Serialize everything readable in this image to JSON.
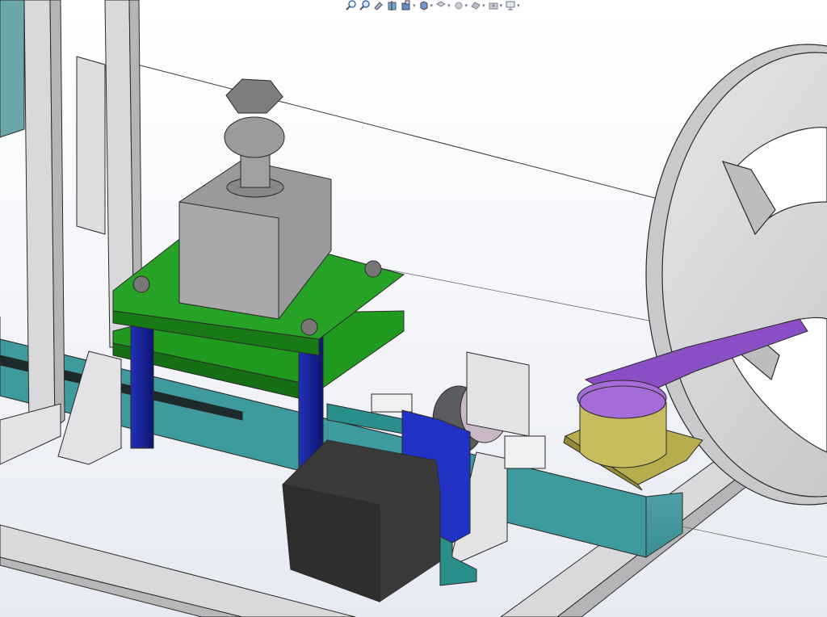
{
  "app": {
    "type": "3D CAD assembly viewport",
    "background_top": "#ffffff",
    "background_bottom": "#e7eaf3"
  },
  "heads_up_toolbar": {
    "tools": [
      {
        "icon": "zoom-to-fit-icon",
        "has_dropdown": false
      },
      {
        "icon": "zoom-to-area-icon",
        "has_dropdown": false
      },
      {
        "icon": "previous-view-icon",
        "has_dropdown": false
      },
      {
        "icon": "section-view-icon",
        "has_dropdown": false
      },
      {
        "icon": "dynamic-annotation-views-icon",
        "has_dropdown": true
      },
      {
        "icon": "view-orientation-icon",
        "has_dropdown": true
      },
      {
        "icon": "display-style-icon",
        "has_dropdown": true
      },
      {
        "icon": "hide-show-items-icon",
        "has_dropdown": true
      },
      {
        "icon": "edit-appearance-icon",
        "has_dropdown": true
      },
      {
        "icon": "apply-scene-icon",
        "has_dropdown": true
      },
      {
        "icon": "view-settings-icon",
        "has_dropdown": true
      }
    ]
  },
  "model": {
    "components": [
      "cylinder-actuator",
      "upper-green-plate",
      "lower-green-plate",
      "blue-guide-pillars",
      "teal-linear-rail",
      "stepper-motor",
      "motor-mount-bracket",
      "blue-mount-plate",
      "sprocket-gears",
      "rail-support-brackets",
      "coupling-hub",
      "olive-base-plate",
      "purple-swing-arm",
      "reel-wheel",
      "vertical-frame-posts",
      "base-frame-rails"
    ],
    "colors": {
      "frame": "#d9d9db",
      "green_plate": "#1f9a1f",
      "blue_pillar": "#17209a",
      "teal_rail": "#4aa9ad",
      "motor": "#3a3a3a",
      "purple_arm": "#8a4fc4",
      "olive_base": "#b7ad4f",
      "reel": "#d4d4d6",
      "actuator": "#9a9a9c",
      "edge": "#2a2a2a"
    }
  }
}
